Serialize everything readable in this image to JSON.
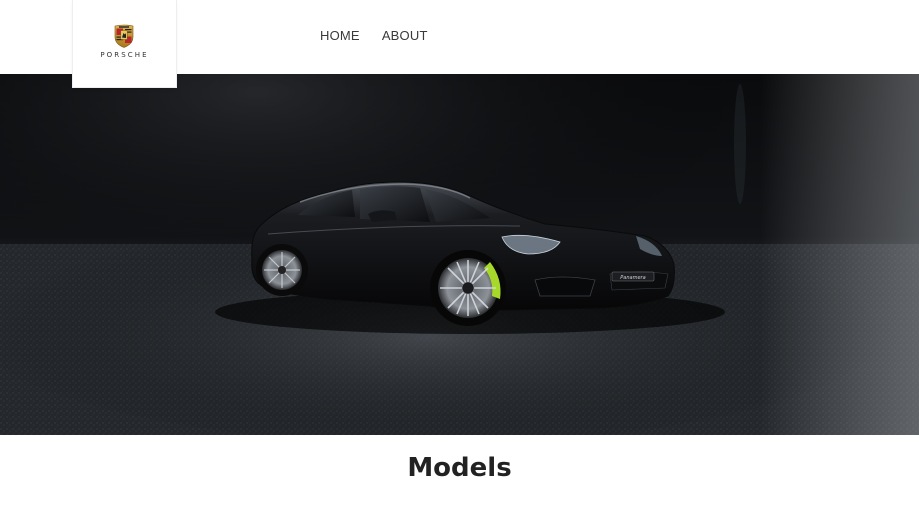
{
  "brand": {
    "wordmark": "PORSCHE"
  },
  "nav": {
    "items": [
      {
        "label": "HOME"
      },
      {
        "label": "ABOUT"
      }
    ]
  },
  "hero": {
    "subject": "black Porsche Panamera on dark floor",
    "plate_text": "Panamera"
  },
  "models_section": {
    "title": "Models"
  },
  "colors": {
    "header_bg": "#ffffff",
    "nav_text": "#3a3a3a",
    "title_text": "#222222",
    "hero_bg": "#0b0c0e",
    "brake_caliper": "#a6d92a"
  }
}
